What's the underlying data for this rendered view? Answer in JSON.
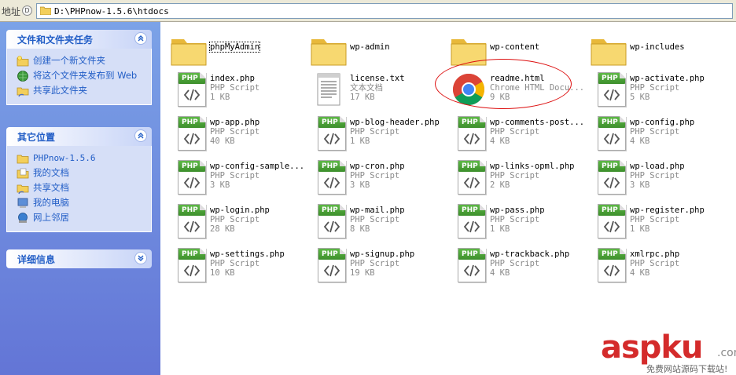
{
  "address_bar": {
    "label": "地址",
    "path": "D:\\PHPnow-1.5.6\\htdocs"
  },
  "sidebar": {
    "tasks_panel": {
      "title": "文件和文件夹任务",
      "items": [
        {
          "label": "创建一个新文件夹",
          "icon": "new-folder-icon"
        },
        {
          "label": "将这个文件夹发布到 Web",
          "icon": "publish-web-icon"
        },
        {
          "label": "共享此文件夹",
          "icon": "share-folder-icon"
        }
      ]
    },
    "places_panel": {
      "title": "其它位置",
      "items": [
        {
          "label": "PHPnow-1.5.6",
          "icon": "folder-icon"
        },
        {
          "label": "我的文档",
          "icon": "my-documents-icon"
        },
        {
          "label": "共享文档",
          "icon": "shared-documents-icon"
        },
        {
          "label": "我的电脑",
          "icon": "my-computer-icon"
        },
        {
          "label": "网上邻居",
          "icon": "network-places-icon"
        }
      ]
    },
    "details_panel": {
      "title": "详细信息"
    }
  },
  "files": [
    {
      "name": "phpMyAdmin",
      "kind": "folder"
    },
    {
      "name": "wp-admin",
      "kind": "folder"
    },
    {
      "name": "wp-content",
      "kind": "folder"
    },
    {
      "name": "wp-includes",
      "kind": "folder"
    },
    {
      "name": "index.php",
      "type": "PHP Script",
      "size": "1 KB",
      "kind": "php"
    },
    {
      "name": "license.txt",
      "type": "文本文档",
      "size": "17 KB",
      "kind": "txt"
    },
    {
      "name": "readme.html",
      "type": "Chrome HTML Docu...",
      "size": "9 KB",
      "kind": "chrome"
    },
    {
      "name": "wp-activate.php",
      "type": "PHP Script",
      "size": "5 KB",
      "kind": "php"
    },
    {
      "name": "wp-app.php",
      "type": "PHP Script",
      "size": "40 KB",
      "kind": "php"
    },
    {
      "name": "wp-blog-header.php",
      "type": "PHP Script",
      "size": "1 KB",
      "kind": "php"
    },
    {
      "name": "wp-comments-post...",
      "type": "PHP Script",
      "size": "4 KB",
      "kind": "php"
    },
    {
      "name": "wp-config.php",
      "type": "PHP Script",
      "size": "4 KB",
      "kind": "php"
    },
    {
      "name": "wp-config-sample...",
      "type": "PHP Script",
      "size": "3 KB",
      "kind": "php"
    },
    {
      "name": "wp-cron.php",
      "type": "PHP Script",
      "size": "3 KB",
      "kind": "php"
    },
    {
      "name": "wp-links-opml.php",
      "type": "PHP Script",
      "size": "2 KB",
      "kind": "php"
    },
    {
      "name": "wp-load.php",
      "type": "PHP Script",
      "size": "3 KB",
      "kind": "php"
    },
    {
      "name": "wp-login.php",
      "type": "PHP Script",
      "size": "28 KB",
      "kind": "php"
    },
    {
      "name": "wp-mail.php",
      "type": "PHP Script",
      "size": "8 KB",
      "kind": "php"
    },
    {
      "name": "wp-pass.php",
      "type": "PHP Script",
      "size": "1 KB",
      "kind": "php"
    },
    {
      "name": "wp-register.php",
      "type": "PHP Script",
      "size": "1 KB",
      "kind": "php"
    },
    {
      "name": "wp-settings.php",
      "type": "PHP Script",
      "size": "10 KB",
      "kind": "php"
    },
    {
      "name": "wp-signup.php",
      "type": "PHP Script",
      "size": "19 KB",
      "kind": "php"
    },
    {
      "name": "wp-trackback.php",
      "type": "PHP Script",
      "size": "4 KB",
      "kind": "php"
    },
    {
      "name": "xmlrpc.php",
      "type": "PHP Script",
      "size": "4 KB",
      "kind": "php"
    }
  ],
  "php_badge": "PHP",
  "watermark": {
    "main": "aspku",
    "suffix": ".com",
    "sub": "免费网站源码下载站!"
  },
  "colors": {
    "sidebar_top": "#7ba2e7",
    "sidebar_bottom": "#6375d6",
    "link": "#215dc6",
    "highlight": "#d11111",
    "php_green": "#4ca537"
  }
}
